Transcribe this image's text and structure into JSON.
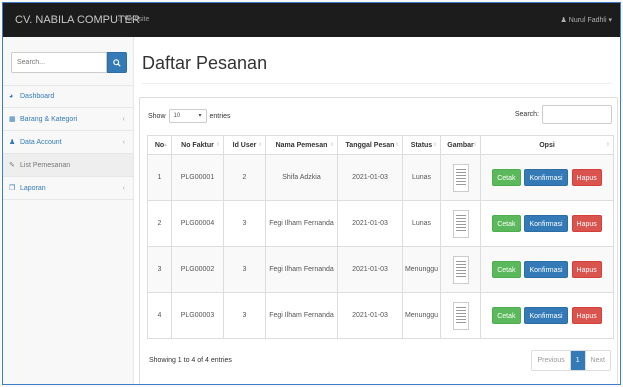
{
  "topbar": {
    "brand": "CV. NABILA COMPUTER",
    "website_link": "Website",
    "user_name": "Nurul Fadhli"
  },
  "sidebar": {
    "search_placeholder": "Search...",
    "items": [
      {
        "label": "Dashboard",
        "icon": "dashboard-icon"
      },
      {
        "label": "Barang & Kategori",
        "icon": "table-icon"
      },
      {
        "label": "Data Account",
        "icon": "users-icon"
      },
      {
        "label": "List Pemesanan",
        "icon": "edit-icon"
      },
      {
        "label": "Laporan",
        "icon": "files-icon"
      }
    ]
  },
  "main": {
    "title": "Daftar Pesanan",
    "show_label": "Show",
    "entries_value": "10",
    "entries_label": "entries",
    "search_label": "Search:",
    "columns": [
      "No",
      "No Faktur",
      "Id User",
      "Nama Pemesan",
      "Tanggal Pesan",
      "Status",
      "Gambar",
      "Opsi"
    ],
    "rows": [
      {
        "no": "1",
        "faktur": "PLG00001",
        "id_user": "2",
        "nama": "Shifa Adzkia",
        "tanggal": "2021-01-03",
        "status": "Lunas"
      },
      {
        "no": "2",
        "faktur": "PLG00004",
        "id_user": "3",
        "nama": "Fegi Ilham Fernanda",
        "tanggal": "2021-01-03",
        "status": "Lunas"
      },
      {
        "no": "3",
        "faktur": "PLG00002",
        "id_user": "3",
        "nama": "Fegi Ilham Fernanda",
        "tanggal": "2021-01-03",
        "status": "Menunggu"
      },
      {
        "no": "4",
        "faktur": "PLG00003",
        "id_user": "3",
        "nama": "Fegi Ilham Fernanda",
        "tanggal": "2021-01-03",
        "status": "Menunggu"
      }
    ],
    "actions": {
      "cetak": "Cetak",
      "konfirmasi": "Konfirmasi",
      "hapus": "Hapus"
    },
    "info": "Showing 1 to 4 of 4 entries",
    "pagination": {
      "previous": "Previous",
      "current": "1",
      "next": "Next"
    }
  },
  "colors": {
    "accent": "#337ab7",
    "success": "#5cb85c",
    "danger": "#d9534f",
    "topbar": "#1c1c1c"
  }
}
